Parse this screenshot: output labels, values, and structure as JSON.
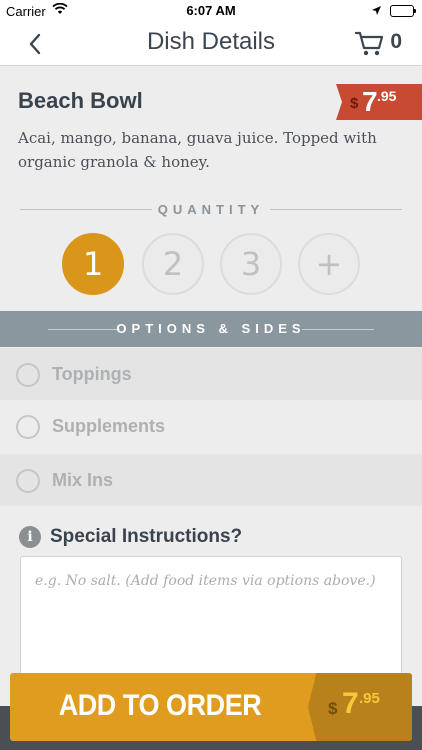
{
  "status_bar": {
    "carrier": "Carrier",
    "time": "6:07 AM"
  },
  "nav": {
    "title": "Dish Details",
    "cart_count": "0"
  },
  "dish": {
    "name": "Beach Bowl",
    "price_currency": "$",
    "price_whole": "7",
    "price_cents": ".95",
    "description": "Acai, mango, banana, guava juice. Topped with organic granola & honey."
  },
  "quantity": {
    "label": "QUANTITY",
    "options": [
      "1",
      "2",
      "3",
      "+"
    ],
    "selected": "1"
  },
  "options": {
    "header": "OPTIONS & SIDES",
    "items": [
      "Toppings",
      "Supplements",
      "Mix Ins"
    ]
  },
  "special": {
    "title": "Special Instructions?",
    "placeholder": "e.g. No salt. (Add food items via options above.)"
  },
  "add_button": {
    "label": "ADD TO ORDER",
    "currency": "$",
    "whole": "7",
    "cents": ".95"
  },
  "colors": {
    "accent": "#d9961b",
    "price_tag": "#c94a33",
    "options_header": "#8a979f"
  }
}
